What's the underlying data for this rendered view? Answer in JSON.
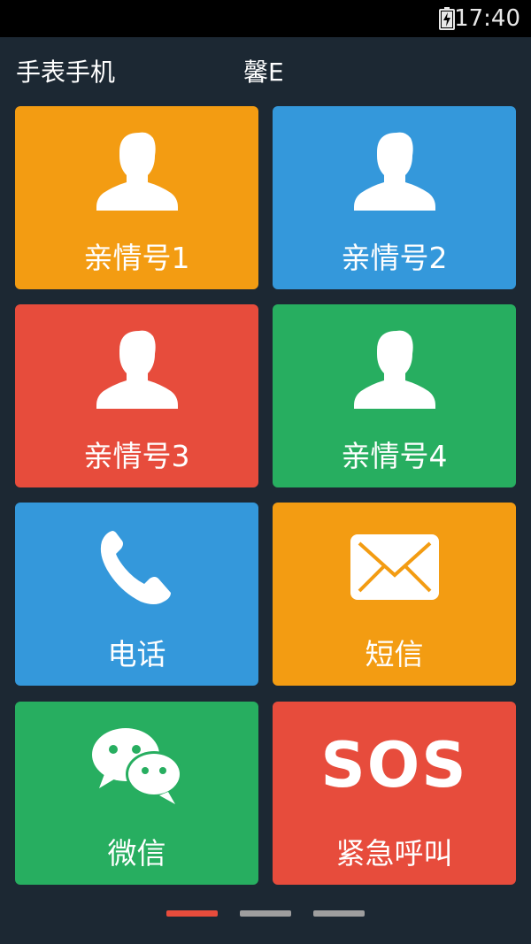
{
  "status_bar": {
    "time": "17:40",
    "battery_icon": "battery-charging-icon"
  },
  "header": {
    "left_title": "手表手机",
    "center_title": "馨E"
  },
  "tiles": [
    {
      "label": "亲情号1",
      "icon": "person-icon",
      "color": "#f39c12"
    },
    {
      "label": "亲情号2",
      "icon": "person-icon",
      "color": "#3498db"
    },
    {
      "label": "亲情号3",
      "icon": "person-icon",
      "color": "#e74c3c"
    },
    {
      "label": "亲情号4",
      "icon": "person-icon",
      "color": "#27ae60"
    },
    {
      "label": "电话",
      "icon": "phone-icon",
      "color": "#3498db"
    },
    {
      "label": "短信",
      "icon": "envelope-icon",
      "color": "#f39c12"
    },
    {
      "label": "微信",
      "icon": "wechat-icon",
      "color": "#27ae60"
    },
    {
      "label": "紧急呼叫",
      "icon": "sos-icon",
      "icon_text": "SOS",
      "color": "#e74c3c"
    }
  ],
  "pager": {
    "pages": 3,
    "active_index": 0,
    "active_color": "#e74c3c",
    "inactive_color": "#9e9e9e"
  },
  "colors": {
    "background": "#1c2833",
    "status_bar": "#000000"
  }
}
